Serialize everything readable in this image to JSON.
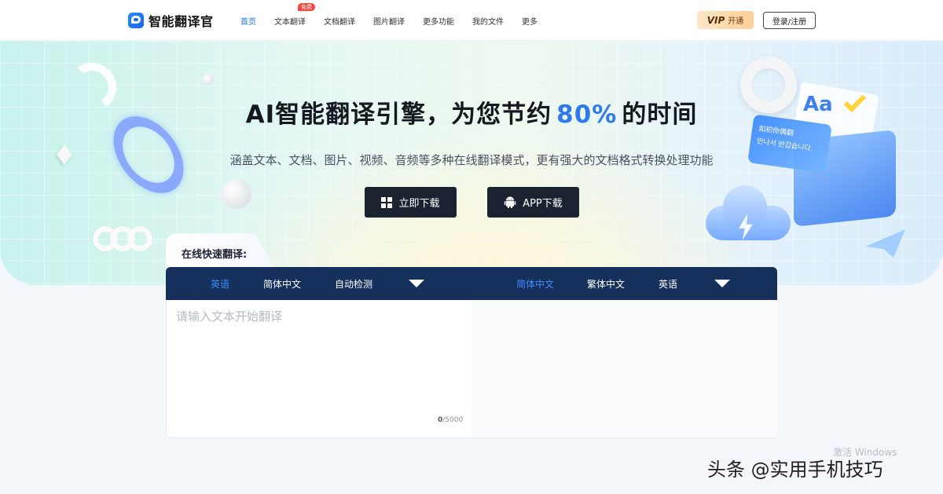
{
  "header": {
    "logo_text": "智能翻译官",
    "nav": [
      {
        "label": "首页",
        "active": true
      },
      {
        "label": "文本翻译",
        "badge": "免费"
      },
      {
        "label": "文档翻译"
      },
      {
        "label": "图片翻译"
      },
      {
        "label": "更多功能"
      },
      {
        "label": "我的文件"
      },
      {
        "label": "更多"
      }
    ],
    "vip_mark": "VIP",
    "vip_label": "开通",
    "login_label": "登录/注册"
  },
  "hero": {
    "title_before": "AI智能翻译引擎，为您节约",
    "title_highlight": "80%",
    "title_after": "的时间",
    "subtitle": "涵盖文本、文档、图片、视频、音频等多种在线翻译模式，更有强大的文档格式转换处理功能",
    "download_button": "立即下载",
    "app_button": "APP下载",
    "card_lines": [
      "如初你偶翻",
      "만나서 반갑습니다."
    ],
    "icon_text": "Aa"
  },
  "translator": {
    "section_label": "在线快速翻译:",
    "source_langs": [
      {
        "label": "英语",
        "active": true
      },
      {
        "label": "简体中文"
      },
      {
        "label": "自动检测"
      }
    ],
    "target_langs": [
      {
        "label": "简体中文",
        "active": true
      },
      {
        "label": "繁体中文"
      },
      {
        "label": "英语"
      }
    ],
    "input_value": "",
    "input_placeholder": "请输入文本开始翻译",
    "char_count": "0",
    "char_limit": "/5000"
  },
  "overlay": {
    "windows_watermark": "激活 Windows",
    "source_watermark": "头条 @实用手机技巧"
  },
  "colors": {
    "accent": "#2d7bea",
    "lang_bar": "#16305c",
    "button_dark": "#1b2230",
    "badge": "#f5453a"
  }
}
